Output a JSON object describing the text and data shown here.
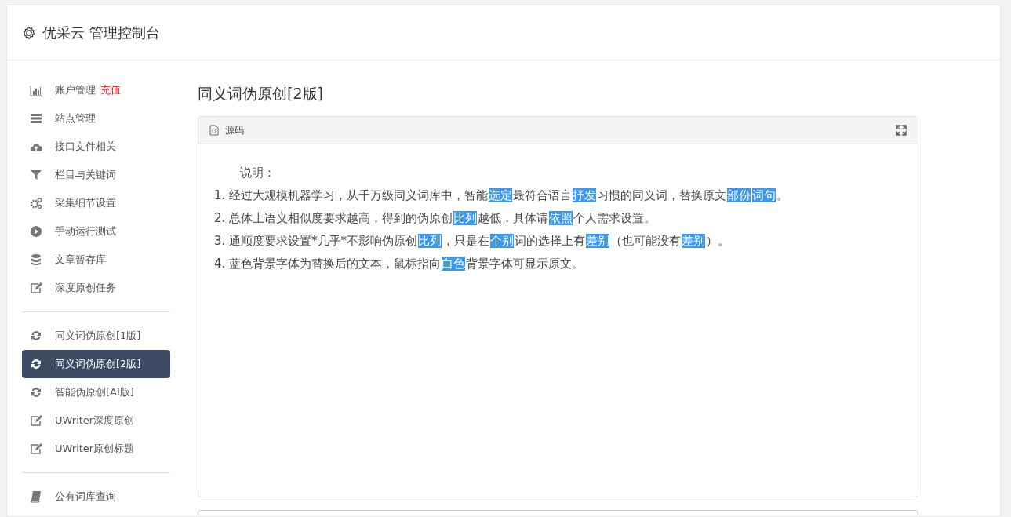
{
  "header": {
    "title": "优采云 管理控制台"
  },
  "sidebar": {
    "groups": [
      {
        "items": [
          {
            "label": "账户管理",
            "badge": "充值",
            "kind": "chart",
            "selected": false
          },
          {
            "label": "站点管理",
            "kind": "server",
            "selected": false
          },
          {
            "label": "接口文件相关",
            "kind": "cloud",
            "selected": false
          },
          {
            "label": "栏目与关键词",
            "kind": "filter",
            "selected": false
          },
          {
            "label": "采集细节设置",
            "kind": "gears",
            "selected": false
          },
          {
            "label": "手动运行测试",
            "kind": "play",
            "selected": false
          },
          {
            "label": "文章暂存库",
            "kind": "database",
            "selected": false
          },
          {
            "label": "深度原创任务",
            "kind": "edit",
            "selected": false
          }
        ]
      },
      {
        "items": [
          {
            "label": "同义词伪原创[1版]",
            "kind": "refresh",
            "selected": false
          },
          {
            "label": "同义词伪原创[2版]",
            "kind": "refresh",
            "selected": true
          },
          {
            "label": "智能伪原创[AI版]",
            "kind": "refresh",
            "selected": false
          },
          {
            "label": "UWriter深度原创",
            "kind": "edit",
            "selected": false
          },
          {
            "label": "UWriter原创标题",
            "kind": "edit",
            "selected": false
          }
        ]
      },
      {
        "items": [
          {
            "label": "公有词库查询",
            "kind": "book",
            "selected": false
          }
        ]
      }
    ]
  },
  "main": {
    "title": "同义词伪原创[2版]",
    "editor": {
      "toolbar_label": "源码",
      "heading": "说明：",
      "lines": [
        [
          {
            "text": "1. 经过大规模机器学习，从千万级同义词库中，智能",
            "replaced": false
          },
          {
            "text": "选定",
            "replaced": true
          },
          {
            "text": "最符合语言",
            "replaced": false
          },
          {
            "text": "抒发",
            "replaced": true
          },
          {
            "text": "习惯的同义词，替换原文",
            "replaced": false
          },
          {
            "text": "部份",
            "replaced": true
          },
          {
            "text": "词句",
            "replaced": true
          },
          {
            "text": "。",
            "replaced": false
          }
        ],
        [
          {
            "text": "2. 总体上语义相似度要求越高，得到的伪原创",
            "replaced": false
          },
          {
            "text": "比列",
            "replaced": true
          },
          {
            "text": "越低，具体请",
            "replaced": false
          },
          {
            "text": "依照",
            "replaced": true
          },
          {
            "text": "个人需求设置。",
            "replaced": false
          }
        ],
        [
          {
            "text": "3. 通顺度要求设置*几乎*不影响伪原创",
            "replaced": false
          },
          {
            "text": "比列",
            "replaced": true
          },
          {
            "text": "，只是在",
            "replaced": false
          },
          {
            "text": "个别",
            "replaced": true
          },
          {
            "text": "词的选择上有",
            "replaced": false
          },
          {
            "text": "差别",
            "replaced": true
          },
          {
            "text": "（也可能没有",
            "replaced": false
          },
          {
            "text": "差别",
            "replaced": true
          },
          {
            "text": "）。",
            "replaced": false
          }
        ],
        [
          {
            "text": "4. 蓝色背景字体为替换后的文本，鼠标指向",
            "replaced": false
          },
          {
            "text": "白色",
            "replaced": true
          },
          {
            "text": "背景字体可显示原文。",
            "replaced": false
          }
        ]
      ]
    }
  }
}
